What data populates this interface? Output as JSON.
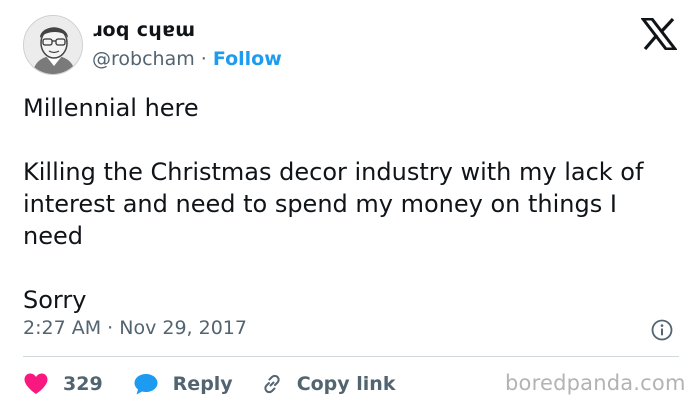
{
  "header": {
    "display_name": "ɹoq cɥɐɯ",
    "handle": "@robcham",
    "separator": "·",
    "follow_label": "Follow"
  },
  "tweet": {
    "paragraphs": [
      "Millennial here",
      "Killing the Christmas decor industry with my lack of interest and need to spend my money on things I need",
      "Sorry"
    ],
    "time": "2:27 AM",
    "separator": "·",
    "date": "Nov 29, 2017"
  },
  "actions": {
    "like_count": "329",
    "reply_label": "Reply",
    "copy_link_label": "Copy link"
  },
  "watermark": "boredpanda.com",
  "colors": {
    "like": "#f91880",
    "reply": "#1d9bf0",
    "follow": "#1d9bf0",
    "secondary_text": "#536471"
  },
  "icons": [
    "avatar",
    "x-logo-icon",
    "info-icon",
    "heart-icon",
    "reply-bubble-icon",
    "link-icon"
  ]
}
